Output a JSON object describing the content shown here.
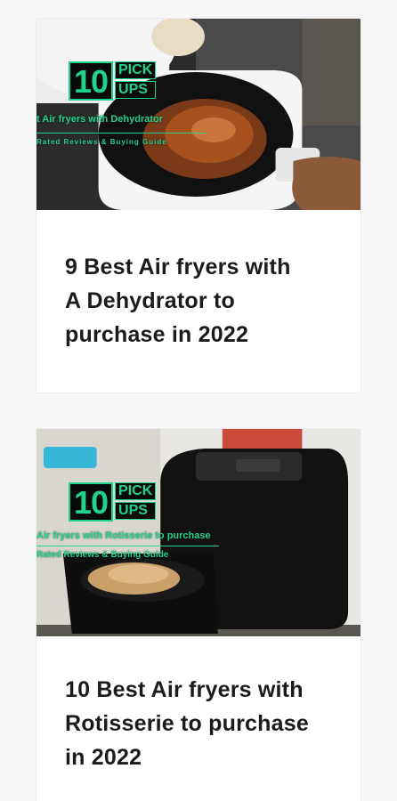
{
  "articles": [
    {
      "title_lines": [
        "9 Best Air fryers with",
        "A Dehydrator to",
        "purchase in 2022"
      ],
      "thumbnail": {
        "logo_number": "10",
        "logo_words": [
          "PICK",
          "UPS"
        ],
        "overlay_title": "t Air fryers with Dehydrator",
        "overlay_subtitle": "Rated Reviews & Buying Guide"
      }
    },
    {
      "title_lines": [
        "10 Best Air fryers with",
        "Rotisserie to purchase",
        "in 2022"
      ],
      "thumbnail": {
        "logo_number": "10",
        "logo_words": [
          "PICK",
          "UPS"
        ],
        "overlay_title": "Air fryers with Rotisserie to purchase",
        "overlay_subtitle": "Rated Reviews & Buying Guide"
      }
    }
  ],
  "colors": {
    "background": "#f7f7f8",
    "card": "#ffffff",
    "title_text": "#1b1b1b",
    "brand_green": "#1fd38a"
  }
}
